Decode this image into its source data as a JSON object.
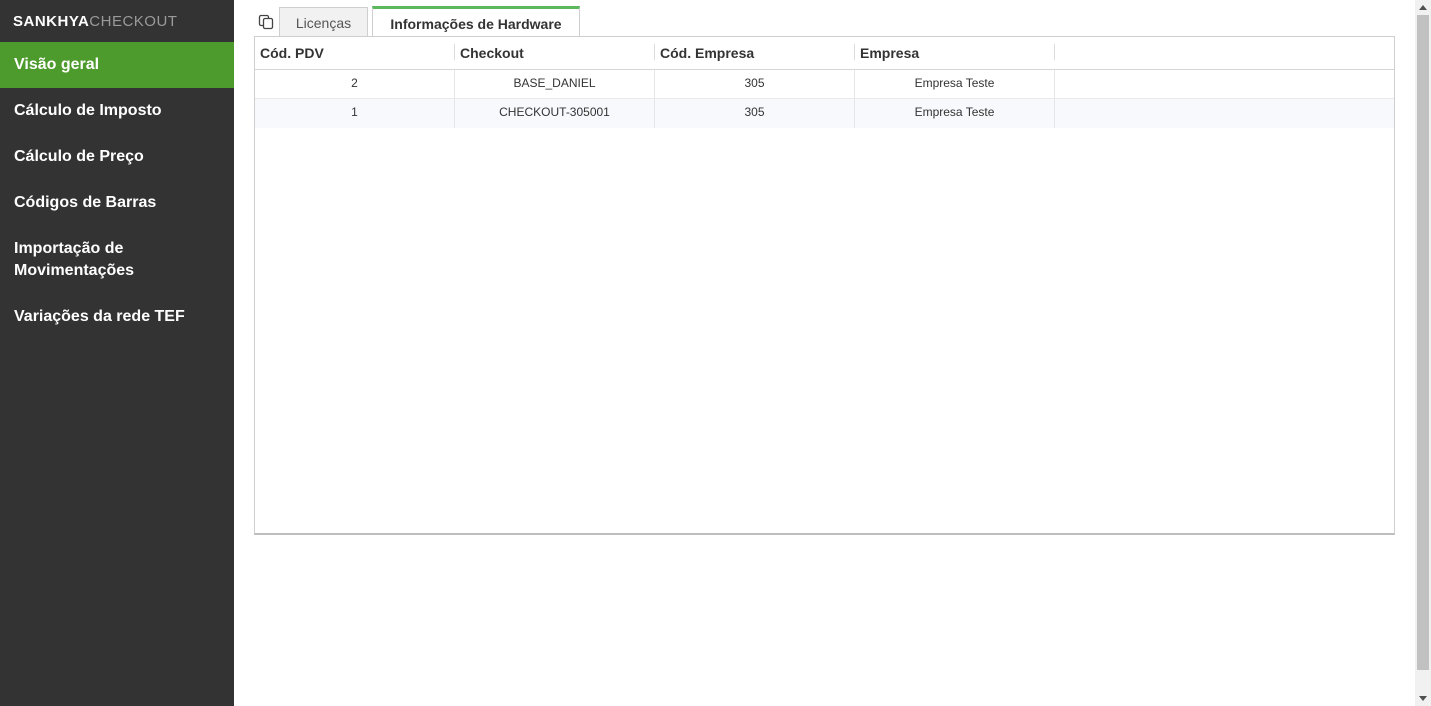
{
  "logo": {
    "brand": "SANKHYA",
    "product": "CHECKOUT"
  },
  "sidebar": {
    "items": [
      {
        "label": "Visão geral",
        "active": true
      },
      {
        "label": "Cálculo de Imposto"
      },
      {
        "label": "Cálculo de Preço"
      },
      {
        "label": "Códigos de Barras"
      },
      {
        "label": "Importação de Movimentações"
      },
      {
        "label": "Variações da rede TEF"
      }
    ]
  },
  "tabs": [
    {
      "label": "Licenças"
    },
    {
      "label": "Informações de Hardware",
      "active": true
    }
  ],
  "grid": {
    "columns": [
      "Cód. PDV",
      "Checkout",
      "Cód. Empresa",
      "Empresa"
    ],
    "rows": [
      [
        "2",
        "BASE_DANIEL",
        "305",
        "Empresa Teste"
      ],
      [
        "1",
        "CHECKOUT-305001",
        "305",
        "Empresa Teste"
      ]
    ]
  },
  "colors": {
    "sidebar_bg": "#333333",
    "active_item": "#4e9b2d",
    "tab_accent": "#5cb85c"
  }
}
